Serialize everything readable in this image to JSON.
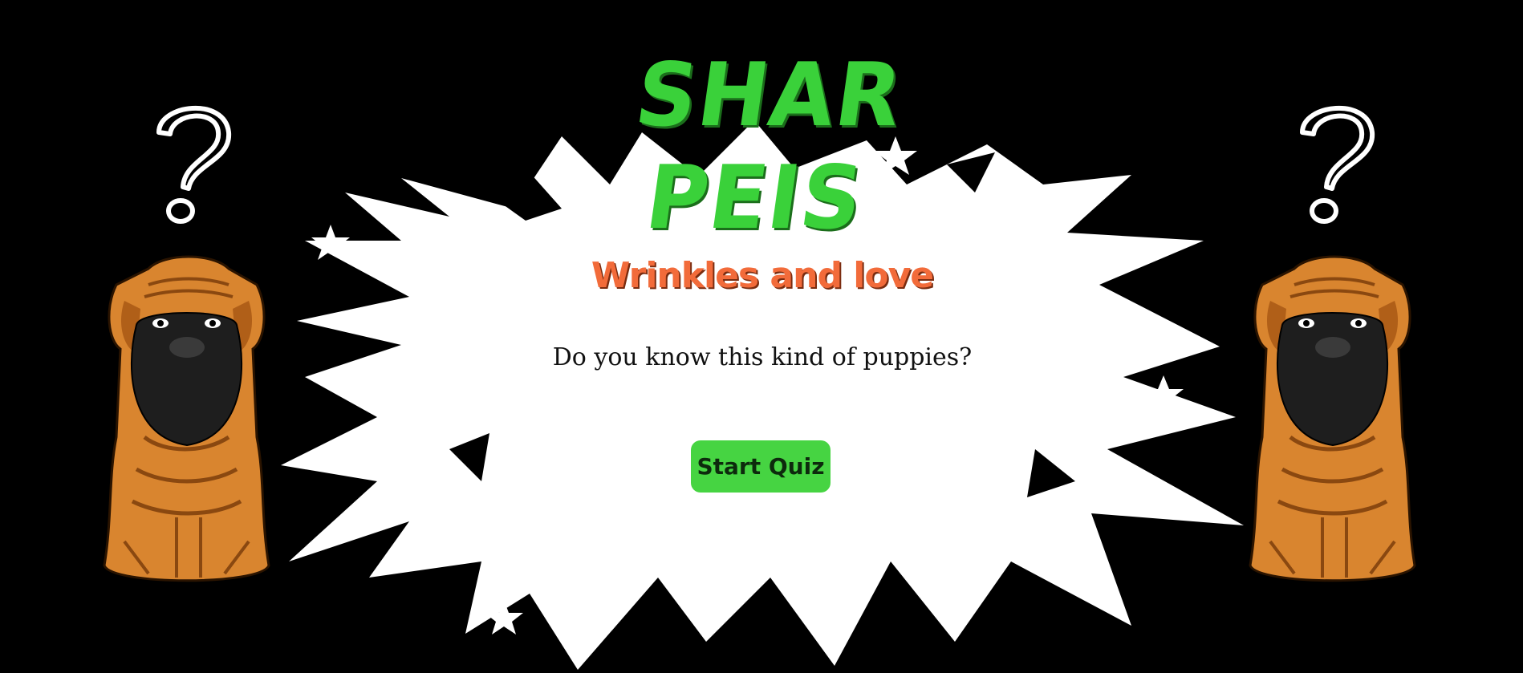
{
  "header": {
    "title": "SHAR PEIS"
  },
  "hero": {
    "subtitle": "Wrinkles and love",
    "question": "Do you know this kind of puppies?",
    "start_label": "Start Quiz"
  },
  "colors": {
    "background": "#000000",
    "title": "#3ad13a",
    "subtitle": "#f26b3a",
    "button": "#46d442",
    "burst": "#ffffff",
    "dog_fur": "#d9852f",
    "dog_muzzle": "#1e1e1e"
  },
  "icons": [
    "question-mark-icon",
    "shar-pei-dog-illustration",
    "star-icon"
  ]
}
